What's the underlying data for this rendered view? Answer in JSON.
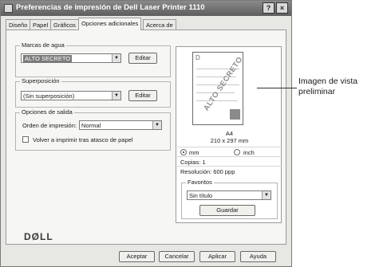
{
  "window": {
    "title": "Preferencias de impresión de Dell Laser Printer 1110",
    "help_button": "?",
    "close_button": "×"
  },
  "tabs": [
    {
      "label": "Diseño"
    },
    {
      "label": "Papel"
    },
    {
      "label": "Gráficos"
    },
    {
      "label": "Opciones adicionales",
      "active": true
    },
    {
      "label": "Acerca de"
    }
  ],
  "watermarks": {
    "title": "Marcas de agua",
    "selected": "ALTO SECRETO",
    "edit_label": "Editar"
  },
  "overlay": {
    "title": "Superposición",
    "selected": "(Sin superposición)",
    "edit_label": "Editar"
  },
  "output_options": {
    "title": "Opciones de salida",
    "print_order_label": "Orden de impresión:",
    "print_order_value": "Normal",
    "reprint_label": "Volver a imprimir tras atasco de papel",
    "reprint_checked": false
  },
  "preview": {
    "watermark_text": "ALTO SECRETO",
    "corner_letter": "D",
    "paper_name": "A4",
    "paper_size": "210 x 297 mm",
    "unit_mm": "mm",
    "unit_inch": "inch",
    "unit_selected": "mm",
    "copies": "Copias: 1",
    "resolution": "Resolución: 600 ppp"
  },
  "favorites": {
    "title": "Favoritos",
    "selected": "Sin título",
    "save_label": "Guardar"
  },
  "brand": {
    "logo_text": "DØLL"
  },
  "footer": {
    "ok": "Aceptar",
    "cancel": "Cancelar",
    "apply": "Aplicar",
    "help": "Ayuda"
  },
  "callout": {
    "text": "Imagen de vista preliminar"
  }
}
